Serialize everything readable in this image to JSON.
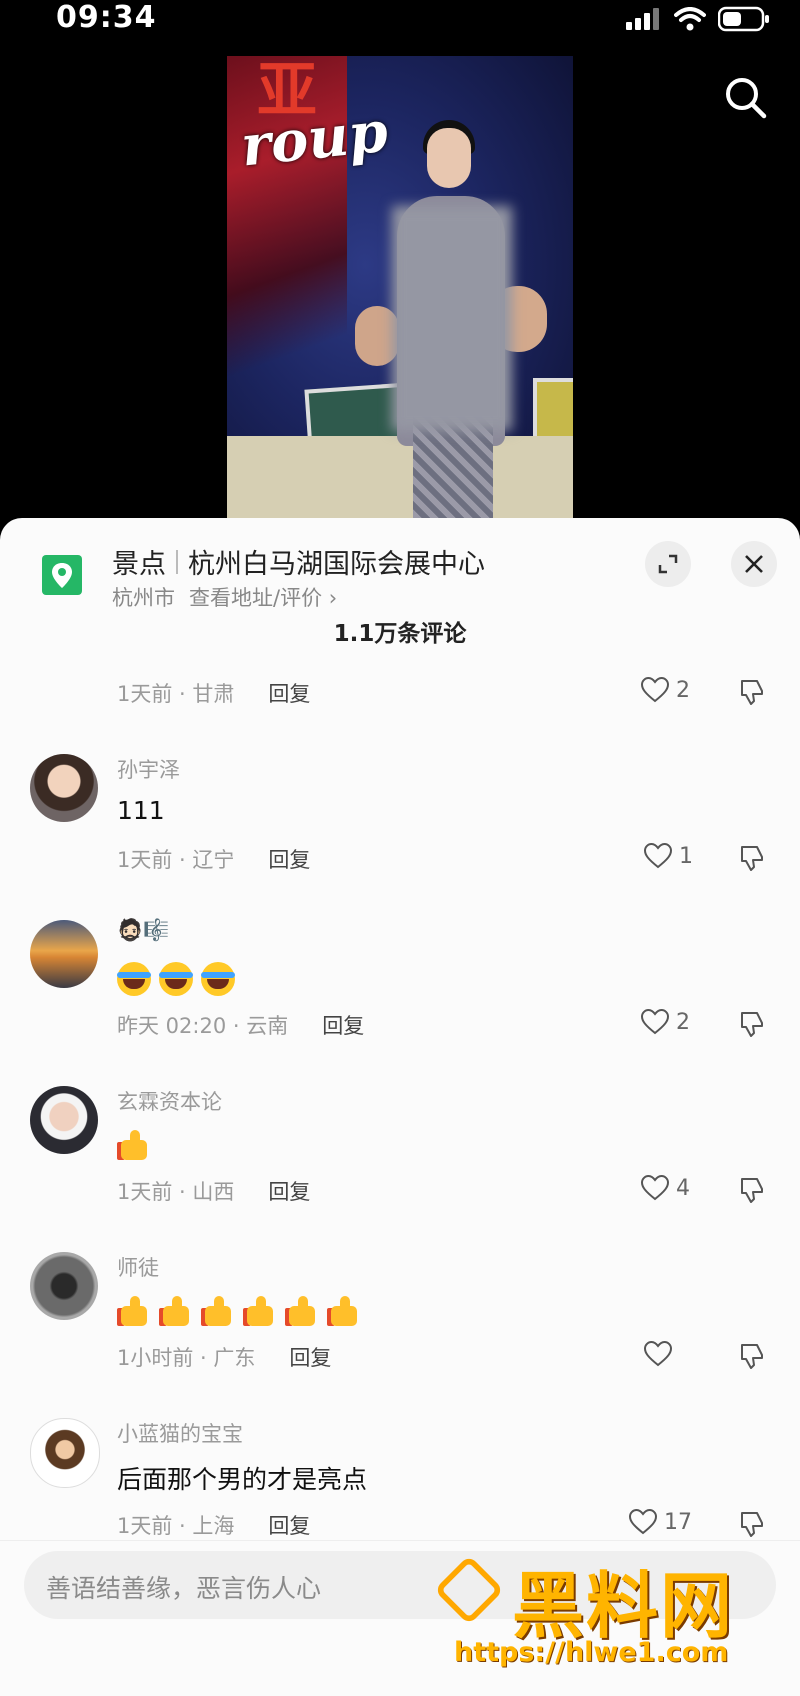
{
  "status": {
    "time": "09:34"
  },
  "video": {
    "overlay_text": "roup"
  },
  "location": {
    "category": "景点",
    "name": "杭州白马湖国际会展中心",
    "city": "杭州市",
    "link": "查看地址/评价 ›"
  },
  "comments_header": "1.1万条评论",
  "comments": [
    {
      "name": "",
      "text": "",
      "meta": "1天前 · 甘肃",
      "reply": "回复",
      "likes": "2"
    },
    {
      "name": "孙宇泽",
      "text": "111",
      "meta": "1天前 · 辽宁",
      "reply": "回复",
      "likes": "1"
    },
    {
      "name": "🧔🏻🎼",
      "text": "😂😂😂",
      "meta": "昨天 02:20 · 云南",
      "reply": "回复",
      "likes": "2"
    },
    {
      "name": "玄霖资本论",
      "text": "👍",
      "meta": "1天前 · 山西",
      "reply": "回复",
      "likes": "4"
    },
    {
      "name": "师徒",
      "text": "👍👍👍👍👍👍",
      "meta": "1小时前 · 广东",
      "reply": "回复",
      "likes": ""
    },
    {
      "name": "小蓝猫的宝宝",
      "text": "后面那个男的才是亮点",
      "meta": "1天前 · 上海",
      "reply": "回复",
      "likes": "17"
    }
  ],
  "input": {
    "placeholder": "善语结善缘，恶言伤人心"
  },
  "watermark": {
    "text": "黑料网",
    "url": "https://hlwe1.com"
  },
  "colors": {
    "location_green": "#25b766",
    "watermark_orange": "#ffb400"
  }
}
